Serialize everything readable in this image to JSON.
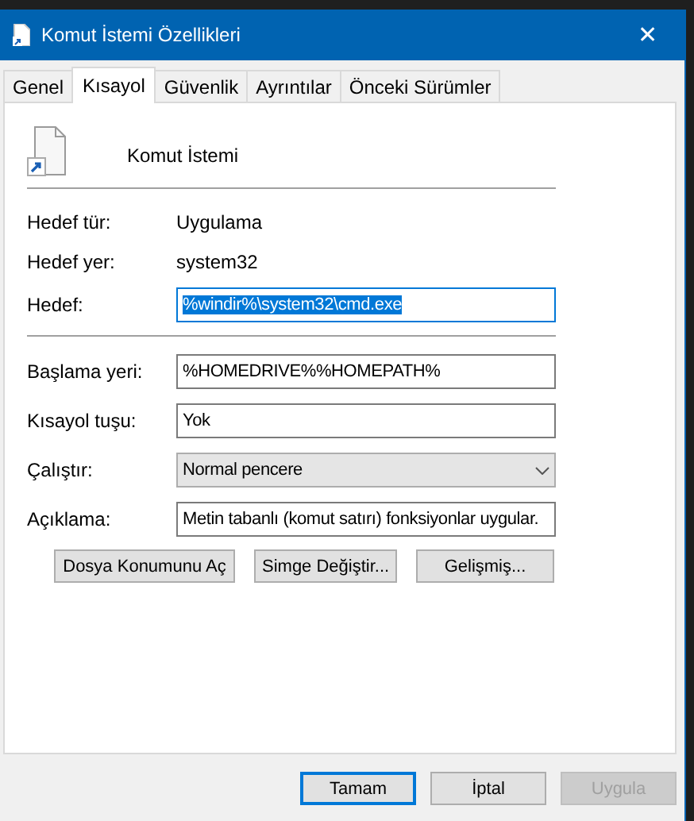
{
  "window": {
    "title": "Komut İstemi Özellikleri",
    "close": "✕"
  },
  "tabs": [
    {
      "label": "Genel",
      "selected": false
    },
    {
      "label": "Kısayol",
      "selected": true
    },
    {
      "label": "Güvenlik",
      "selected": false
    },
    {
      "label": "Ayrıntılar",
      "selected": false
    },
    {
      "label": "Önceki Sürümler",
      "selected": false
    }
  ],
  "shortcut": {
    "name": "Komut İstemi",
    "info": [
      {
        "label": "Hedef tür:",
        "value": "Uygulama"
      },
      {
        "label": "Hedef yer:",
        "value": "system32"
      }
    ],
    "target": {
      "label": "Hedef:",
      "value": "%windir%\\system32\\cmd.exe",
      "focused": true
    },
    "fields": [
      {
        "kind": "text",
        "label": "Başlama yeri:",
        "value": "%HOMEDRIVE%%HOMEPATH%",
        "focused": false
      },
      {
        "kind": "text",
        "label": "Kısayol tuşu:",
        "value": "Yok",
        "focused": false
      },
      {
        "kind": "dropdown",
        "label": "Çalıştır:",
        "value": "Normal pencere"
      },
      {
        "kind": "text",
        "label": "Açıklama:",
        "value": "Metin tabanlı (komut satırı) fonksiyonlar uygular.",
        "focused": false
      }
    ],
    "buttons": [
      "Dosya Konumunu Aç",
      "Simge Değiştir...",
      "Gelişmiş..."
    ]
  },
  "dialog_buttons": [
    {
      "label": "Tamam",
      "default": true,
      "disabled": false
    },
    {
      "label": "İptal",
      "default": false,
      "disabled": false
    },
    {
      "label": "Uygula",
      "default": false,
      "disabled": true
    }
  ]
}
